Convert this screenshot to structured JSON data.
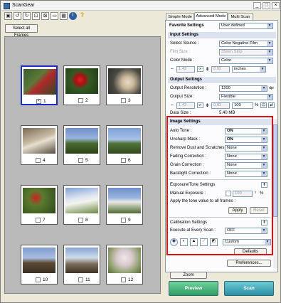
{
  "window": {
    "title": "ScanGear"
  },
  "toolbar": {
    "select_all_frames": "Select all Frames",
    "info_icon": "i",
    "help_icon": "?"
  },
  "frames": [
    {
      "num": "1",
      "checked": true
    },
    {
      "num": "2",
      "checked": false
    },
    {
      "num": "3",
      "checked": false
    },
    {
      "num": "4",
      "checked": false
    },
    {
      "num": "5",
      "checked": false
    },
    {
      "num": "6",
      "checked": false
    },
    {
      "num": "7",
      "checked": false
    },
    {
      "num": "8",
      "checked": false
    },
    {
      "num": "9",
      "checked": false
    },
    {
      "num": "10",
      "checked": false
    },
    {
      "num": "11",
      "checked": false
    },
    {
      "num": "12",
      "checked": false
    }
  ],
  "tabs": [
    "Simple Mode",
    "Advanced Mode",
    "Multi Scan"
  ],
  "favorite": {
    "label": "Favorite Settings",
    "value": "User defined"
  },
  "input_settings": {
    "header": "Input Settings",
    "select_source_label": "Select Source :",
    "select_source_value": "Color Negative Film",
    "film_size_label": "Film Size :",
    "film_size_value": "35mm Strip",
    "color_mode_label": "Color Mode :",
    "color_mode_value": "Color",
    "width": "1.42",
    "height": "0.92",
    "unit": "inches"
  },
  "output_settings": {
    "header": "Output Settings",
    "resolution_label": "Output Resolution :",
    "resolution_value": "1200",
    "resolution_unit": "dpi",
    "size_label": "Output Size :",
    "size_value": "Flexible",
    "width": "1.42",
    "height": "0.92",
    "scale": "100",
    "scale_unit": "%",
    "data_size_label": "Data Size :",
    "data_size_value": "5.40 MB"
  },
  "image_settings": {
    "header": "Image Settings",
    "rows": [
      {
        "label": "Auto Tone :",
        "value": "ON"
      },
      {
        "label": "Unsharp Mask :",
        "value": "ON"
      },
      {
        "label": "Remove Dust and Scratches :",
        "value": "None"
      },
      {
        "label": "Fading Correction :",
        "value": "None"
      },
      {
        "label": "Grain Correction :",
        "value": "None"
      },
      {
        "label": "Backlight Correction :",
        "value": "None"
      }
    ]
  },
  "exposure": {
    "header": "Exposure/Tone Settings",
    "manual_label": "Manual Exposure :",
    "manual_value": "100",
    "apply_all_label": "Apply the tone value to all frames :",
    "apply_button": "Apply",
    "reset_button": "Reset"
  },
  "calibration": {
    "header": "Calibration Settings",
    "execute_label": "Execute at Every Scan :",
    "execute_value": "OFF"
  },
  "custom": {
    "value": "Custom",
    "defaults_button": "Defaults"
  },
  "buttons": {
    "preferences": "Preferences...",
    "zoom": "Zoom",
    "preview": "Preview",
    "scan": "Scan"
  },
  "colors": {
    "accent": "#1a2bcc",
    "highlight": "#e01010",
    "action": "#3aa8b8"
  }
}
